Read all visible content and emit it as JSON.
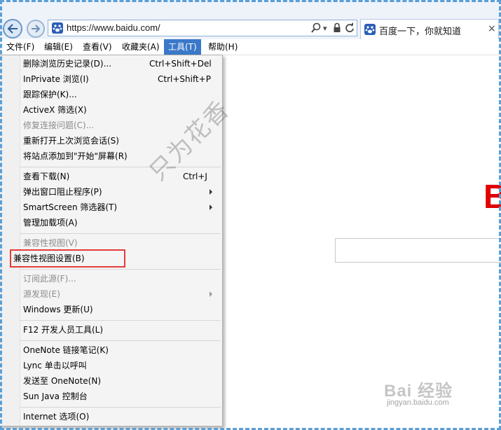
{
  "browser": {
    "url": "https://www.baidu.com/",
    "tab_title": "百度一下，你就知道",
    "tab_close": "×"
  },
  "menubar": {
    "items": [
      {
        "label": "文件(F)"
      },
      {
        "label": "编辑(E)"
      },
      {
        "label": "查看(V)"
      },
      {
        "label": "收藏夹(A)"
      },
      {
        "label": "工具(T)",
        "active": true
      },
      {
        "label": "帮助(H)"
      }
    ]
  },
  "tools_menu": {
    "items": [
      {
        "label": "删除浏览历史记录(D)...",
        "shortcut": "Ctrl+Shift+Del"
      },
      {
        "label": "InPrivate 浏览(I)",
        "shortcut": "Ctrl+Shift+P"
      },
      {
        "label": "跟踪保护(K)..."
      },
      {
        "label": "ActiveX 筛选(X)"
      },
      {
        "label": "修复连接问题(C)...",
        "disabled": true
      },
      {
        "label": "重新打开上次浏览会话(S)"
      },
      {
        "label": "将站点添加到\"开始\"屏幕(R)"
      },
      {
        "label": "查看下载(N)",
        "shortcut": "Ctrl+J"
      },
      {
        "label": "弹出窗口阻止程序(P)",
        "submenu": true
      },
      {
        "label": "SmartScreen 筛选器(T)",
        "submenu": true
      },
      {
        "label": "管理加载项(A)"
      },
      {
        "label": "兼容性视图(V)",
        "disabled": true
      },
      {
        "label": "兼容性视图设置(B)",
        "highlighted": true
      },
      {
        "label": "订阅此源(F)...",
        "disabled": true
      },
      {
        "label": "源发现(E)",
        "disabled": true,
        "submenu": true
      },
      {
        "label": "Windows 更新(U)"
      },
      {
        "label": "F12 开发人员工具(L)"
      },
      {
        "label": "OneNote 链接笔记(K)"
      },
      {
        "label": "Lync 单击以呼叫"
      },
      {
        "label": "发送至 OneNote(N)"
      },
      {
        "label": "Sun Java 控制台"
      },
      {
        "label": "Internet 选项(O)"
      }
    ]
  },
  "watermark": {
    "text": "只为花香",
    "site": "Bai 经验",
    "site_url": "jingyan.baidu.com"
  },
  "colors": {
    "accent": "#3a78c9",
    "highlight_box": "#e43a3a",
    "baidu_red": "#e10000",
    "frame": "#5a9fd6"
  },
  "icons": [
    "back-arrow-icon",
    "forward-arrow-icon",
    "search-icon",
    "lock-icon",
    "refresh-icon",
    "baidu-paw-icon",
    "close-icon",
    "submenu-arrow-icon"
  ]
}
